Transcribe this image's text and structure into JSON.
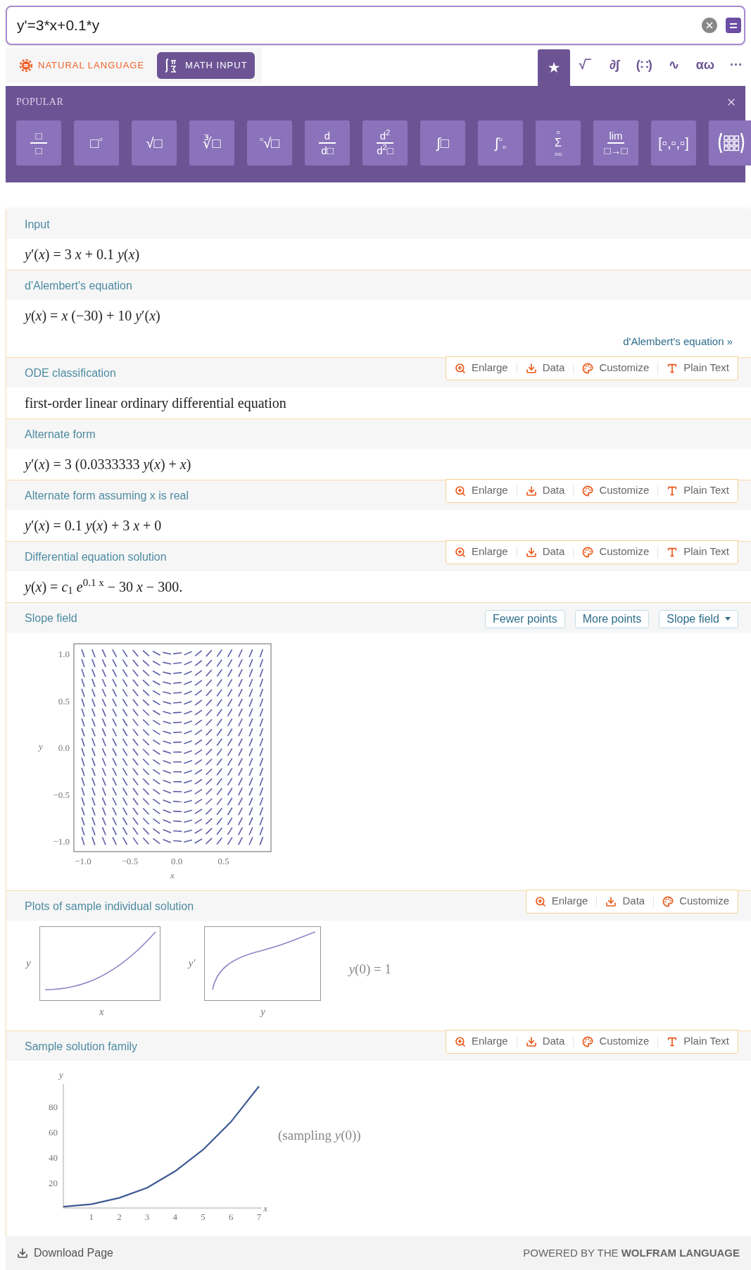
{
  "search": {
    "value": "y'=3*x+0.1*y"
  },
  "modes": [
    {
      "label": "NATURAL LANGUAGE",
      "selected": false,
      "kind": "natural"
    },
    {
      "label": "MATH INPUT",
      "selected": true,
      "kind": "math"
    }
  ],
  "palette_tabs": [
    {
      "label": "★",
      "selected": true
    },
    {
      "label": "√‾",
      "selected": false
    },
    {
      "label": "∂∫",
      "selected": false
    },
    {
      "label": "(∷)",
      "selected": false
    },
    {
      "label": "∿",
      "selected": false
    },
    {
      "label": "αω",
      "selected": false
    },
    {
      "label": "···",
      "selected": false
    }
  ],
  "palette": {
    "title": "POPULAR",
    "buttons": [
      {
        "kind": "stack",
        "top": "□",
        "bottom": "□"
      },
      {
        "kind": "inline",
        "text": "□$^{▫}$"
      },
      {
        "kind": "inline",
        "text": "√□"
      },
      {
        "kind": "inline",
        "text": "∛□"
      },
      {
        "kind": "inline",
        "text": "$^{▫}$√□"
      },
      {
        "kind": "stack",
        "top": "d",
        "bottom": "d□"
      },
      {
        "kind": "stack",
        "top": "d$^{2}$",
        "bottom": "d$^{2}$□"
      },
      {
        "kind": "inline",
        "text": "∫□"
      },
      {
        "kind": "inline",
        "text": "∫$^{▫}$$_{▫}$"
      },
      {
        "kind": "stack",
        "top": "▫",
        "mid": "Σ",
        "bottom": "▫▫"
      },
      {
        "kind": "stack",
        "top": "lim",
        "bottom": "□→□"
      },
      {
        "kind": "inline",
        "text": "[▫,▫,▫]"
      },
      {
        "kind": "matrix"
      }
    ]
  },
  "pods": [
    {
      "kind": "math",
      "title": "Input",
      "content": "*y*′(*x*) = 3 *x* + 0.1 *y*(*x*)"
    },
    {
      "kind": "math",
      "title": "d'Alembert's equation",
      "content": "*y*(*x*) = *x* (−30) + 10 *y*′(*x*)",
      "link": "d'Alembert's equation »"
    },
    {
      "kind": "text",
      "title": "ODE classification",
      "content": "first-order linear ordinary differential equation",
      "actions": [
        {
          "kind": "enlarge",
          "label": "Enlarge"
        },
        {
          "kind": "data",
          "label": "Data"
        },
        {
          "kind": "customize",
          "label": "Customize"
        },
        {
          "kind": "plain_text",
          "label": "Plain Text"
        }
      ]
    },
    {
      "kind": "math",
      "title": "Alternate form",
      "content": "*y*′(*x*) = 3 (0.0333333 *y*(*x*) + *x*)"
    },
    {
      "kind": "math",
      "title": "Alternate form assuming x is real",
      "content": "*y*′(*x*) = 0.1 *y*(*x*) + 3 *x* + 0",
      "actions": [
        {
          "kind": "enlarge",
          "label": "Enlarge"
        },
        {
          "kind": "data",
          "label": "Data"
        },
        {
          "kind": "customize",
          "label": "Customize"
        },
        {
          "kind": "plain_text",
          "label": "Plain Text"
        }
      ]
    },
    {
      "kind": "math",
      "title": "Differential equation solution",
      "content": "*y*(*x*) = *c*$_{1}$ *e*$^{0.1 x}$ − 30 *x* − 300.",
      "actions": [
        {
          "kind": "enlarge",
          "label": "Enlarge"
        },
        {
          "kind": "data",
          "label": "Data"
        },
        {
          "kind": "customize",
          "label": "Customize"
        },
        {
          "kind": "plain_text",
          "label": "Plain Text"
        }
      ]
    },
    {
      "kind": "slope_field",
      "title": "Slope field",
      "buttons": [
        {
          "label": "Fewer points",
          "kind": "plain"
        },
        {
          "label": "More points",
          "kind": "plain"
        },
        {
          "label": "Slope field",
          "kind": "dropdown"
        }
      ],
      "xticks": [
        "−1.0",
        "−0.5",
        "0.0",
        "0.5"
      ],
      "yticks": [
        "1.0",
        "0.5",
        "0.0",
        "−0.5",
        "−1.0"
      ],
      "xlabel": "x",
      "ylabel": "y"
    },
    {
      "kind": "sample_plots",
      "title": "Plots of sample individual solution",
      "actions": [
        {
          "kind": "enlarge",
          "label": "Enlarge"
        },
        {
          "kind": "data",
          "label": "Data"
        },
        {
          "kind": "customize",
          "label": "Customize"
        }
      ],
      "plots": [
        {
          "kind": "solution",
          "ylabel": "y",
          "xlabel": "x"
        },
        {
          "kind": "phase",
          "ylabel": "y′",
          "xlabel": "y"
        }
      ],
      "condition": "*y*(0) = 1"
    },
    {
      "kind": "family",
      "title": "Sample solution family",
      "actions": [
        {
          "kind": "enlarge",
          "label": "Enlarge"
        },
        {
          "kind": "data",
          "label": "Data"
        },
        {
          "kind": "customize",
          "label": "Customize"
        },
        {
          "kind": "plain_text",
          "label": "Plain Text"
        }
      ],
      "note": "(sampling *y*(0))",
      "chart_data": {
        "type": "line",
        "xlabel": "x",
        "ylabel": "y",
        "x": [
          0,
          1,
          2,
          3,
          4,
          5,
          6,
          7
        ],
        "series": [
          {
            "color": "#3e5a94",
            "values": [
              1,
              3,
              8,
              16,
              29,
              46,
              68,
              96
            ]
          }
        ],
        "xlim": [
          0,
          7.1
        ],
        "ylim": [
          0,
          98
        ],
        "xticks": [
          1,
          2,
          3,
          4,
          5,
          6,
          7
        ],
        "yticks": [
          20,
          40,
          60,
          80
        ]
      }
    }
  ],
  "footer": {
    "download": "Download Page",
    "powered": "POWERED BY THE **WOLFRAM LANGUAGE**"
  }
}
